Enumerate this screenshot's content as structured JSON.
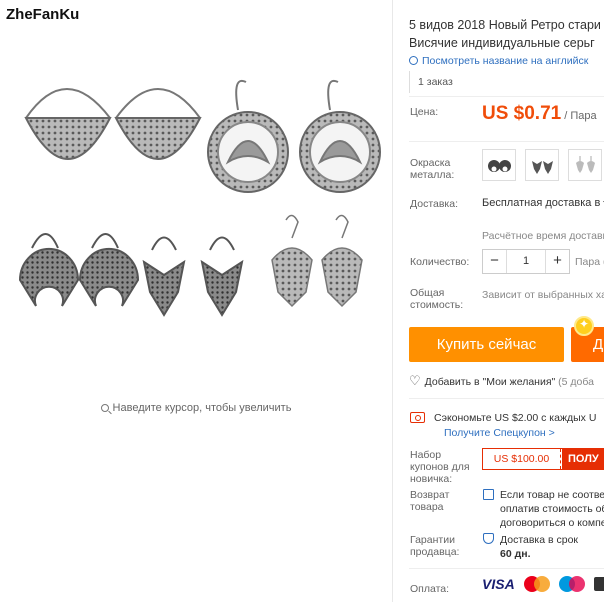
{
  "watermark": "ZheFanKu",
  "zoom_hint": "Наведите курсор, чтобы увеличить",
  "product": {
    "title_line1": "5 видов 2018 Новый Ретро стари",
    "title_line2": "Висячие индивидуальные серьг",
    "translate_link": "Посмотреть название на английск",
    "orders": "1 заказ"
  },
  "price": {
    "label": "Цена:",
    "amount": "US $0.71",
    "unit": "/ Пара"
  },
  "color": {
    "label_line1": "Окраска",
    "label_line2": "металла:",
    "swatches": [
      "swatch-1",
      "swatch-2",
      "swatch-3",
      "swatch-4"
    ]
  },
  "shipping": {
    "label": "Доставка:",
    "method": "Бесплатная доставка в",
    "time": "Расчётное время доставки"
  },
  "quantity": {
    "label": "Количество:",
    "minus": "−",
    "value": "1",
    "plus": "+",
    "unit": "Пара ("
  },
  "total": {
    "label_line1": "Общая",
    "label_line2": "стоимость:",
    "note": "Зависит от выбранных ха"
  },
  "buttons": {
    "buy_now": "Купить сейчас",
    "add_cart": "Д"
  },
  "wishlist": {
    "label": "Добавить в \"Мои желания\"",
    "count": "(5 доба"
  },
  "savings": {
    "text": "Сэкономьте US $2.00 с каждых U",
    "link": "Получите Спецкупон >"
  },
  "coupon": {
    "label_line1": "Набор",
    "label_line2": "купонов для",
    "label_line3": "новичка:",
    "value": "US $100.00",
    "get": "ПОЛУ"
  },
  "returns": {
    "label_line1": "Возврат",
    "label_line2": "товара",
    "line1": "Если товар не соответ",
    "line2": "оплатив стоимость об",
    "line3": "договориться о компе"
  },
  "guarantee": {
    "label_line1": "Гарантии",
    "label_line2": "продавца:",
    "line1": "Доставка в срок",
    "line2": "60 дн."
  },
  "payment": {
    "label": "Оплата:",
    "visa": "VISA"
  },
  "colors": {
    "accent_orange": "#ff9000",
    "price_red": "#f04d0a",
    "link_blue": "#2e6fbf",
    "coupon_red": "#e62e04"
  }
}
